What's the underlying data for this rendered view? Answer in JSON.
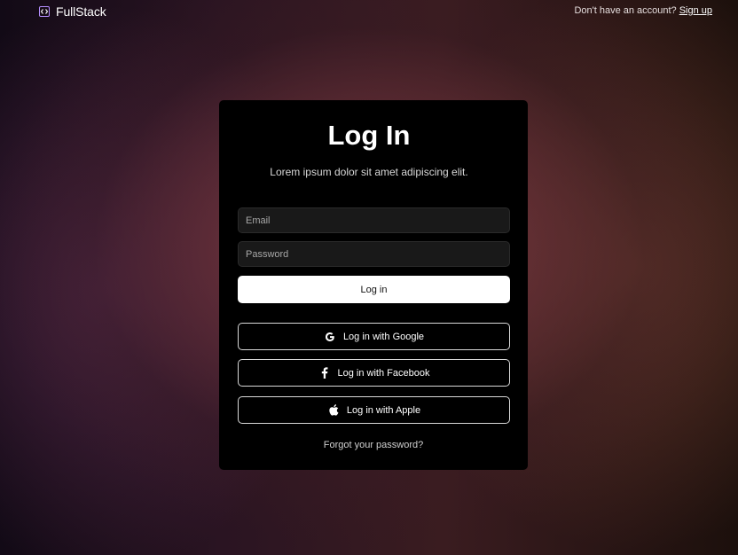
{
  "header": {
    "brand": "FullStack",
    "brand_icon": "code-brackets-icon",
    "signup_prompt": "Don't have an account?",
    "signup_link": "Sign up"
  },
  "login": {
    "title": "Log In",
    "subtitle": "Lorem ipsum dolor sit amet adipiscing elit.",
    "email_placeholder": "Email",
    "email_value": "",
    "password_placeholder": "Password",
    "password_value": "",
    "login_button": "Log in",
    "google_button": "Log in with Google",
    "facebook_button": "Log in with Facebook",
    "apple_button": "Log in with Apple",
    "forgot_password": "Forgot your password?"
  },
  "icons": {
    "google": "google-icon",
    "facebook": "facebook-icon",
    "apple": "apple-icon"
  },
  "colors": {
    "card_background": "#000000",
    "primary_button": "#ffffff",
    "logo_accent": "#b58fff",
    "input_background": "#191919"
  }
}
